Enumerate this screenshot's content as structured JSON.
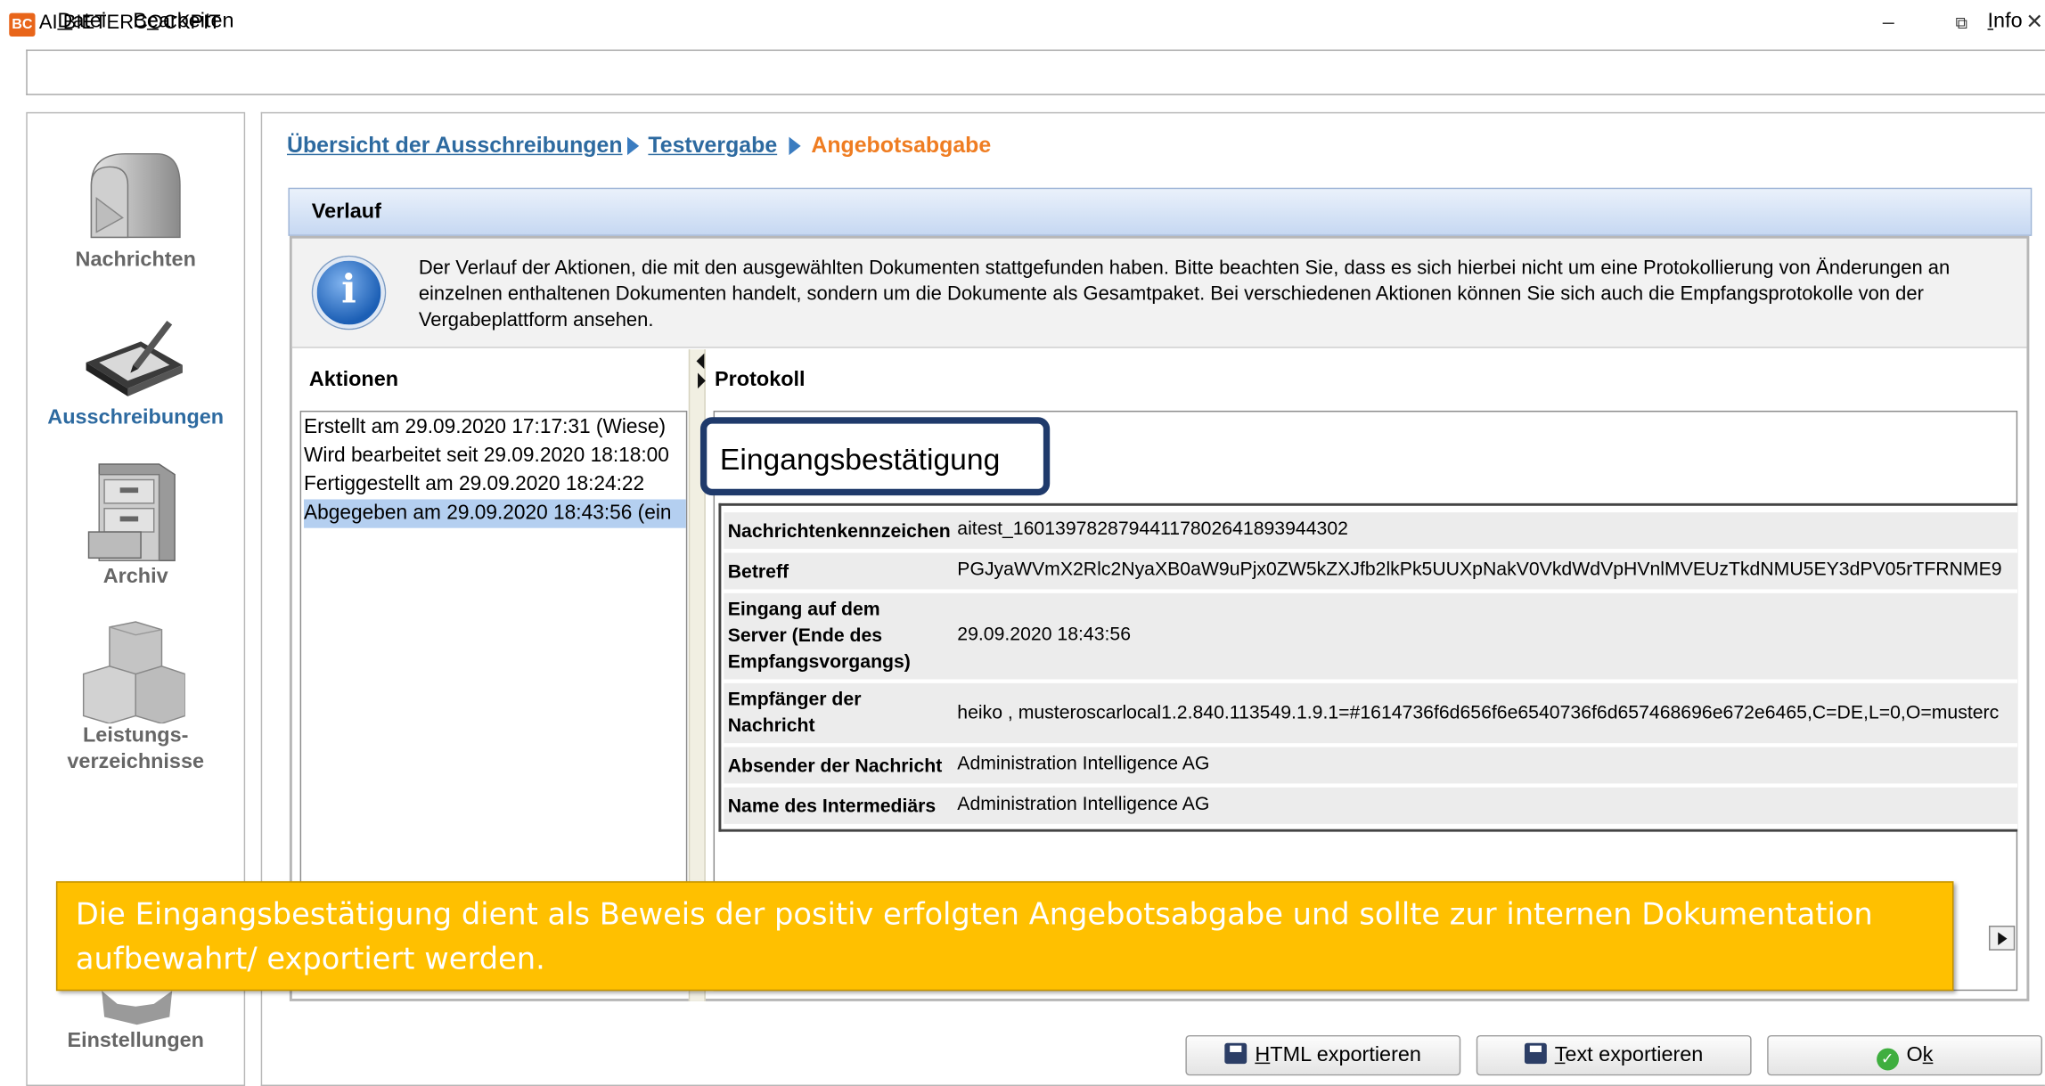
{
  "window": {
    "logo": "BC",
    "title": "AI BIETERCOCKPIT",
    "controls": {
      "minimize": "–",
      "restore": "⧉",
      "close": "✕"
    }
  },
  "menu": {
    "datei": "D",
    "datei_rest": "atei",
    "bearbeiten_pre": "B",
    "bearbeiten_u": "e",
    "bearbeiten_rest": "arbeiten",
    "info_u": "I",
    "info_rest": "nfo"
  },
  "sidebar": {
    "items": [
      {
        "label": "Nachrichten",
        "icon": "mailbox-icon",
        "active": false
      },
      {
        "label": "Ausschreibungen",
        "icon": "tablet-pen-icon",
        "active": true
      },
      {
        "label": "Archiv",
        "icon": "filing-cabinet-icon",
        "active": false
      },
      {
        "label": "Leistungs-",
        "label2": "verzeichnisse",
        "icon": "boxes-icon",
        "active": false
      },
      {
        "label": "Einstellungen",
        "icon": "gear-icon",
        "active": false
      }
    ]
  },
  "breadcrumb": {
    "item1": "Übersicht der Ausschreibungen",
    "item2": "Testvergabe",
    "current": "Angebotsabgabe"
  },
  "verlauf": {
    "title": "Verlauf",
    "info_text": "Der Verlauf der Aktionen, die mit den ausgewählten Dokumenten stattgefunden haben. Bitte beachten Sie, dass es sich hierbei nicht um eine Protokollierung von Änderungen an einzelnen enthaltenen Dokumenten handelt, sondern um die Dokumente als Gesamtpaket. Bei verschiedenen Aktionen können Sie sich auch die Empfangsprotokolle von der Vergabeplattform ansehen."
  },
  "aktionen": {
    "title": "Aktionen",
    "items": [
      {
        "text": "Erstellt am 29.09.2020 17:17:31 (Wiese)",
        "selected": false
      },
      {
        "text": "Wird bearbeitet seit 29.09.2020 18:18:00",
        "selected": false
      },
      {
        "text": "Fertiggestellt am 29.09.2020 18:24:22",
        "selected": false
      },
      {
        "text": "Abgegeben am 29.09.2020 18:43:56 (ein",
        "selected": true
      }
    ]
  },
  "protokoll": {
    "title": "Protokoll",
    "heading": "Eingangsbestätigung",
    "rows": [
      {
        "label": "Nachrichtenkennzeichen",
        "value": "aitest_16013978287944117802641893944302"
      },
      {
        "label": "Betreff",
        "value": "PGJyaWVmX2Rlc2NyaXB0aW9uPjx0ZW5kZXJfb2lkPk5UUXpNakV0VkdWdVpHVnlMVEUzTkdNMU5EY3dPV05rTFRNME9"
      },
      {
        "label": "Eingang auf dem Server (Ende des Empfangsvorgangs)",
        "value": "29.09.2020 18:43:56"
      },
      {
        "label": "Empfänger der Nachricht",
        "value": "heiko , musteroscarlocal1.2.840.113549.1.9.1=#1614736f6d656f6e6540736f6d657468696e672e6465,C=DE,L=0,O=musterc"
      },
      {
        "label": "Absender der Nachricht",
        "value": "Administration Intelligence AG"
      },
      {
        "label": "Name des Intermediärs",
        "value": "Administration Intelligence AG"
      }
    ]
  },
  "callout": {
    "text": "Die Eingangsbestätigung dient als Beweis der positiv erfolgten Angebotsabgabe und sollte zur internen Dokumentation aufbewahrt/ exportiert werden.",
    "color": "#ffc000"
  },
  "buttons": {
    "html_u": "H",
    "html_rest": "TML exportieren",
    "text_u": "T",
    "text_rest": "ext exportieren",
    "ok_pre": "O",
    "ok_u": "k"
  },
  "colors": {
    "accent_link": "#2d6aa0",
    "breadcrumb_current": "#ef7d22",
    "selection": "#b4cff0"
  }
}
